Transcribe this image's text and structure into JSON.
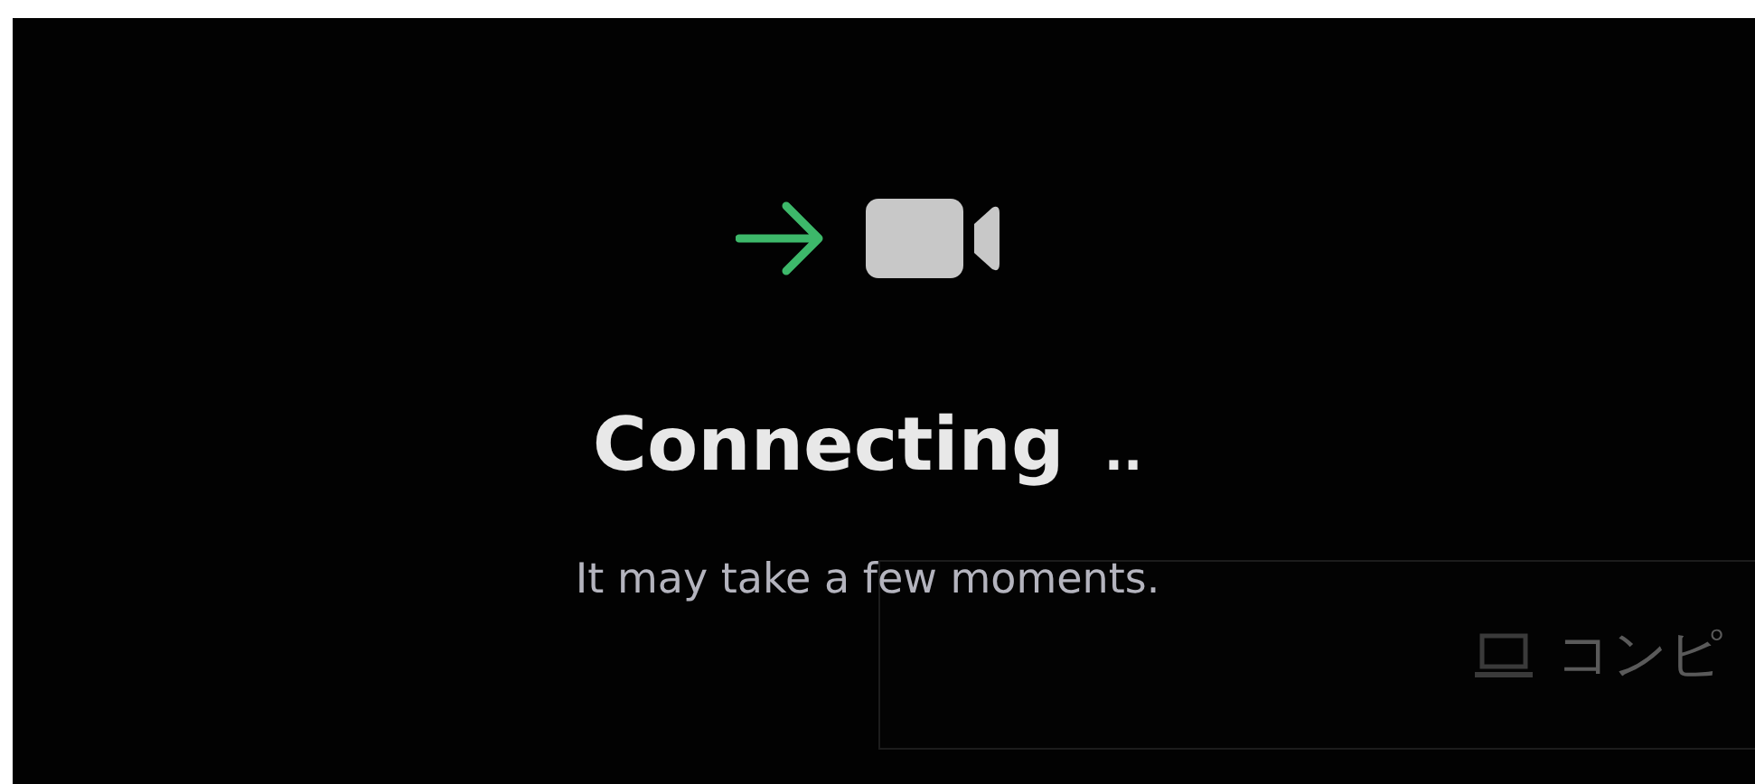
{
  "status": {
    "title": "Connecting",
    "dots": "..",
    "message": "It may take a few moments."
  },
  "background_panel": {
    "label": "コンピ"
  }
}
